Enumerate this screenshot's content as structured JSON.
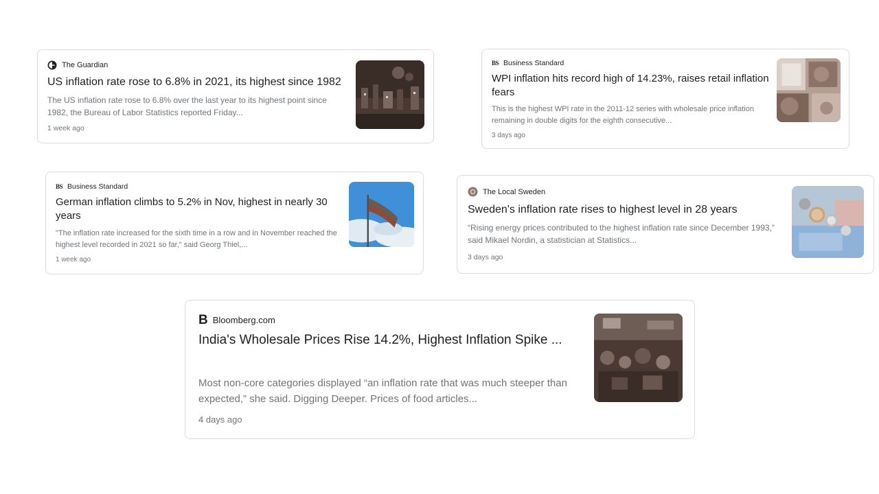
{
  "articles": [
    {
      "source": "The Guardian",
      "source_icon": "guardian-logo-icon",
      "title": "US inflation rate rose to 6.8% in 2021, its highest since 1982",
      "snippet": "The US inflation rate rose to 6.8% over the last year to its highest point since 1982, the Bureau of Labor Statistics reported Friday...",
      "time": "1 week ago",
      "thumbnail": "city-night-photo"
    },
    {
      "source": "Business Standard",
      "source_icon": "business-standard-logo-icon",
      "title": "WPI inflation hits record high of 14.23%, raises retail inflation fears",
      "snippet": "This is the highest WPI rate in the 2011-12 series with wholesale price inflation remaining in double digits for the eighth consecutive...",
      "time": "3 days ago",
      "thumbnail": "grocery-items-photo"
    },
    {
      "source": "Business Standard",
      "source_icon": "business-standard-logo-icon",
      "title": "German inflation climbs to 5.2% in Nov, highest in nearly 30 years",
      "snippet": "\"The inflation rate increased for the sixth time in a row and in November reached the highest level recorded in 2021 so far,\" said Georg Thiel,...",
      "time": "1 week ago",
      "thumbnail": "flag-sky-photo"
    },
    {
      "source": "The Local Sweden",
      "source_icon": "the-local-logo-icon",
      "title": "Sweden's inflation rate rises to highest level in 28 years",
      "snippet": "“Rising energy prices contributed to the highest inflation rate since December 1993,” said Mikael Nordin, a statistician at Statistics...",
      "time": "3 days ago",
      "thumbnail": "coins-banknotes-photo"
    },
    {
      "source": "Bloomberg.com",
      "source_icon": "bloomberg-logo-icon",
      "title": "India's Wholesale Prices Rise 14.2%, Highest Inflation Spike ...",
      "snippet": "Most non-core categories displayed “an inflation rate that was much steeper than expected,” she said. Digging Deeper. Prices of food articles...",
      "time": "4 days ago",
      "thumbnail": "market-crowd-photo"
    }
  ],
  "logo_text": {
    "business_standard": "BS",
    "bloomberg": "B"
  },
  "colors": {
    "title": "#1f1f1f",
    "snippet": "#70757a",
    "border": "#dadce0"
  }
}
